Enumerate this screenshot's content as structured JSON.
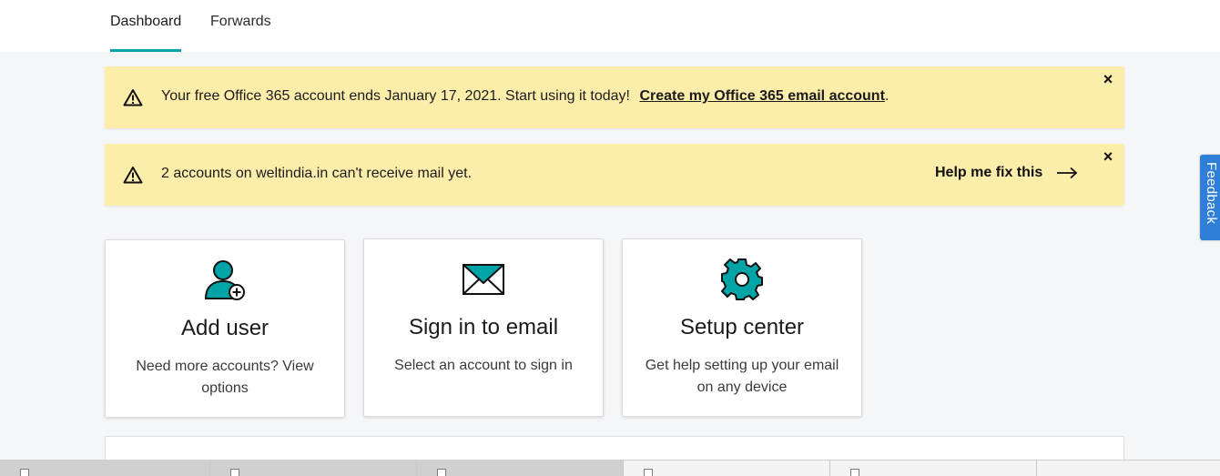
{
  "nav": {
    "tabs": [
      {
        "label": "Dashboard",
        "active": true
      },
      {
        "label": "Forwards",
        "active": false
      }
    ]
  },
  "banners": [
    {
      "icon": "warning-icon",
      "text": "Your free Office 365 account ends January 17, 2021. Start using it today!",
      "link": "Create my Office 365 email account",
      "suffix": ".",
      "close": "×"
    },
    {
      "icon": "warning-icon",
      "text": "2 accounts on weltindia.in can't receive mail yet.",
      "action": "Help me fix this",
      "action_icon": "arrow-right-icon",
      "close": "×"
    }
  ],
  "cards": [
    {
      "icon": "add-user-icon",
      "title": "Add user",
      "description": "Need more accounts? View options"
    },
    {
      "icon": "envelope-icon",
      "title": "Sign in to email",
      "description": "Select an account to sign in"
    },
    {
      "icon": "gear-icon",
      "title": "Setup center",
      "description": "Get help setting up your email on any device"
    }
  ],
  "feedback": {
    "label": "Feedback"
  },
  "colors": {
    "accent": "#00a4a6",
    "banner_bg": "#fdedab",
    "feedback_bg": "#2f7ed8",
    "page_bg": "#f5f6f7"
  }
}
